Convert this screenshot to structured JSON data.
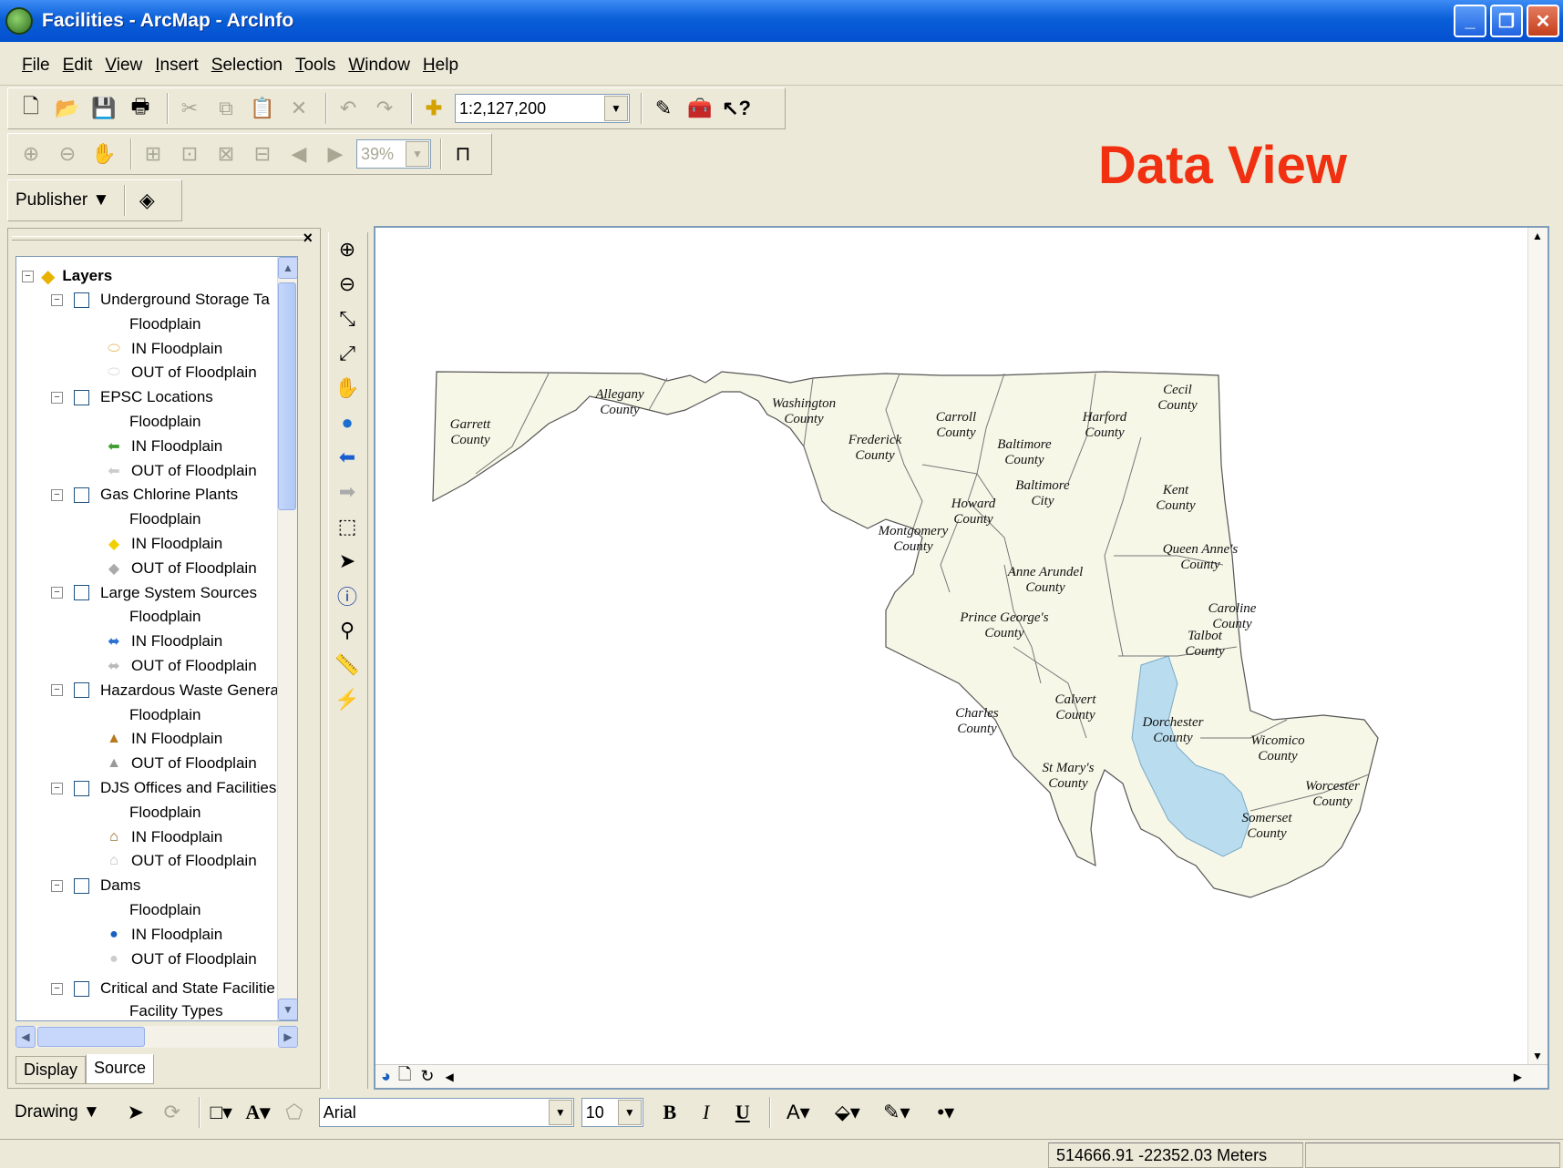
{
  "window": {
    "title": "Facilities - ArcMap - ArcInfo",
    "min_label": "_",
    "restore_label": "❐",
    "close_label": "✕"
  },
  "menu": [
    {
      "u": "F",
      "rest": "ile"
    },
    {
      "u": "E",
      "rest": "dit"
    },
    {
      "u": "V",
      "rest": "iew"
    },
    {
      "u": "I",
      "rest": "nsert"
    },
    {
      "u": "S",
      "rest": "election"
    },
    {
      "u": "T",
      "rest": "ools"
    },
    {
      "u": "W",
      "rest": "indow"
    },
    {
      "u": "H",
      "rest": "elp"
    }
  ],
  "standard_toolbar": {
    "scale": "1:2,127,200"
  },
  "layout_toolbar": {
    "zoom": "39%"
  },
  "publisher_toolbar": {
    "label": "Publisher"
  },
  "overlay_label": "Data View",
  "toc": {
    "root": "Layers",
    "groups": [
      {
        "name": "Underground Storage Ta",
        "field": "Floodplain",
        "in": "IN Floodplain",
        "out": "OUT of Floodplain",
        "in_color": "#e8c070",
        "out_color": "#ddd"
      },
      {
        "name": "EPSC Locations",
        "field": "Floodplain",
        "in": "IN Floodplain",
        "out": "OUT of Floodplain",
        "in_color": "#3c9a2c",
        "out_color": "#ccc"
      },
      {
        "name": "Gas Chlorine Plants",
        "field": "Floodplain",
        "in": "IN Floodplain",
        "out": "OUT of Floodplain",
        "in_color": "#f2d000",
        "out_color": "#aaa"
      },
      {
        "name": "Large System Sources",
        "field": "Floodplain",
        "in": "IN Floodplain",
        "out": "OUT of Floodplain",
        "in_color": "#2a6fd0",
        "out_color": "#bbb"
      },
      {
        "name": "Hazardous Waste Genera",
        "field": "Floodplain",
        "in": "IN Floodplain",
        "out": "OUT of Floodplain",
        "in_color": "#b7791f",
        "out_color": "#999"
      },
      {
        "name": "DJS Offices and Facilities",
        "field": "Floodplain",
        "in": "IN Floodplain",
        "out": "OUT of Floodplain",
        "in_color": "#8a5a14",
        "out_color": "#bbb"
      },
      {
        "name": "Dams",
        "field": "Floodplain",
        "in": "IN Floodplain",
        "out": "OUT of Floodplain",
        "in_color": "#1a5fc0",
        "out_color": "#ccc"
      }
    ],
    "last_group": {
      "name": "Critical and State Facilitie",
      "field": "Facility Types"
    },
    "tabs": {
      "display": "Display",
      "source": "Source"
    }
  },
  "map": {
    "counties": [
      {
        "name": "Garrett",
        "sub": "County"
      },
      {
        "name": "Allegany",
        "sub": "County"
      },
      {
        "name": "Washington",
        "sub": "County"
      },
      {
        "name": "Frederick",
        "sub": "County"
      },
      {
        "name": "Carroll",
        "sub": "County"
      },
      {
        "name": "Baltimore",
        "sub": "County"
      },
      {
        "name": "Harford",
        "sub": "County"
      },
      {
        "name": "Cecil",
        "sub": "County"
      },
      {
        "name": "Baltimore",
        "sub": "City"
      },
      {
        "name": "Howard",
        "sub": "County"
      },
      {
        "name": "Kent",
        "sub": "County"
      },
      {
        "name": "Montgomery",
        "sub": "County"
      },
      {
        "name": "Queen Anne's",
        "sub": "County"
      },
      {
        "name": "Anne Arundel",
        "sub": "County"
      },
      {
        "name": "Caroline",
        "sub": "County"
      },
      {
        "name": "Prince George's",
        "sub": "County"
      },
      {
        "name": "Talbot",
        "sub": "County"
      },
      {
        "name": "Calvert",
        "sub": "County"
      },
      {
        "name": "Charles",
        "sub": "County"
      },
      {
        "name": "Dorchester",
        "sub": "County"
      },
      {
        "name": "Wicomico",
        "sub": "County"
      },
      {
        "name": "St Mary's",
        "sub": "County"
      },
      {
        "name": "Worcester",
        "sub": "County"
      },
      {
        "name": "Somerset",
        "sub": "County"
      }
    ],
    "land_color": "#f7f7e8",
    "water_color": "#b9dcef"
  },
  "drawing_toolbar": {
    "label": "Drawing",
    "font": "Arial",
    "size": "10",
    "bold": "B",
    "italic": "I",
    "underline": "U"
  },
  "status": {
    "coords": "514666.91  -22352.03 Meters"
  }
}
